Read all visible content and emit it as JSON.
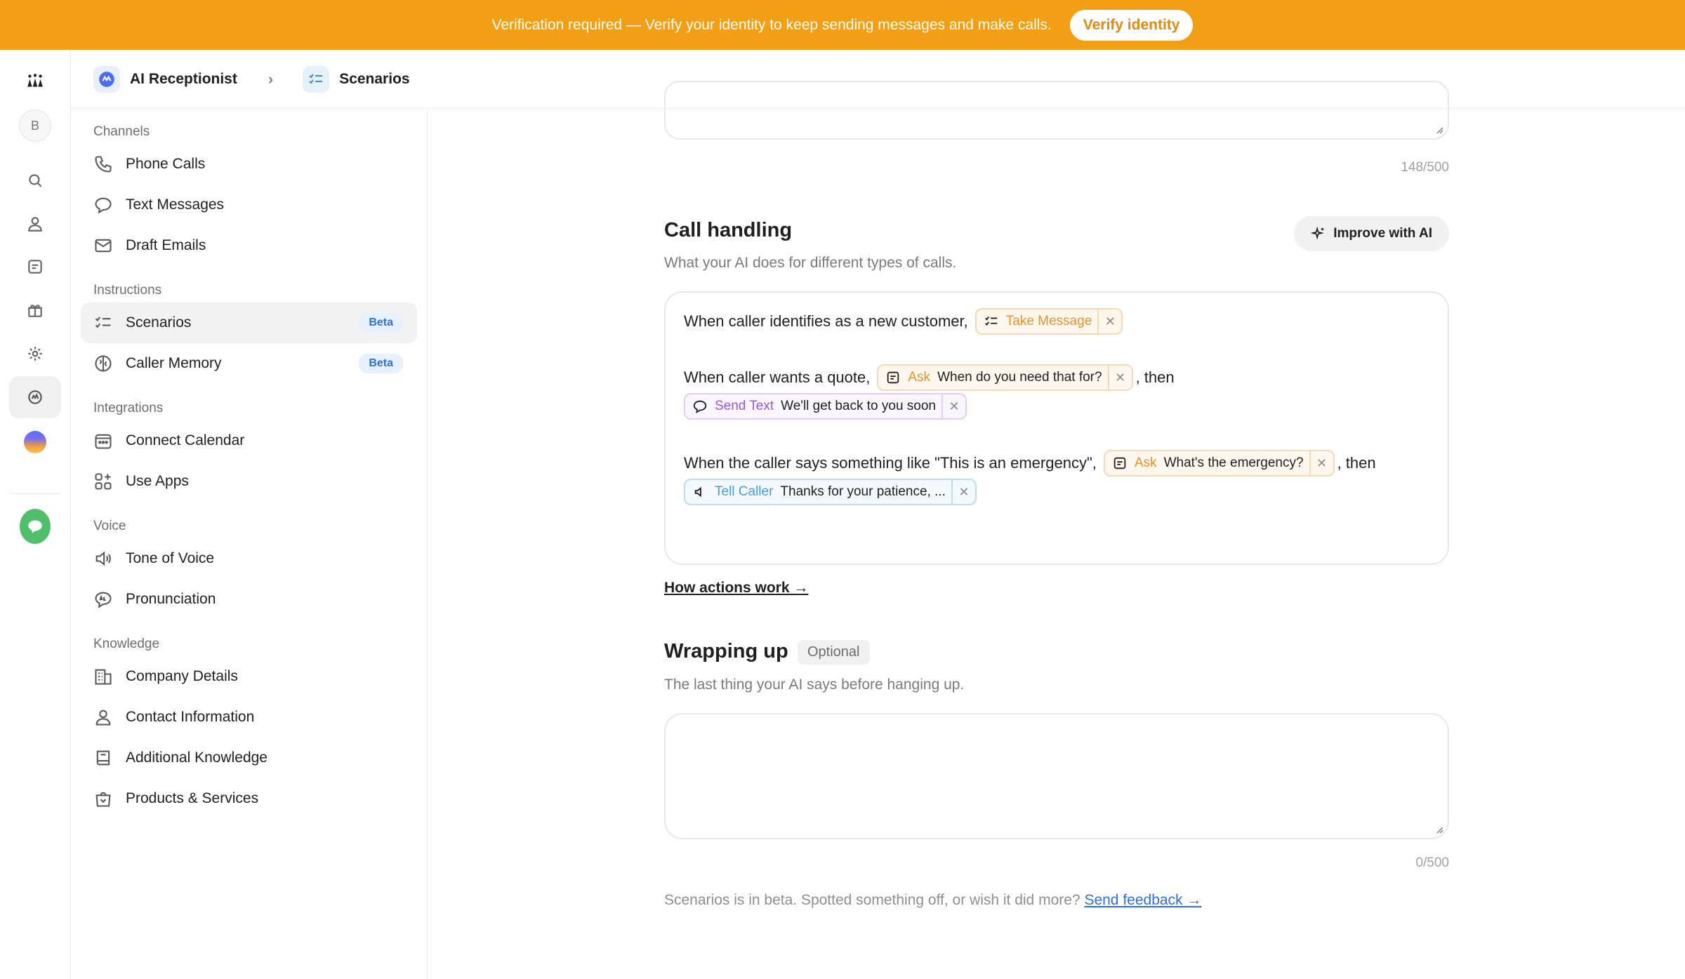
{
  "banner": {
    "text": "Verification required — Verify your identity to keep sending messages and make calls.",
    "button": "Verify identity",
    "color": "#f29f16"
  },
  "rail": {
    "avatar_letter": "B",
    "icons": [
      "team-logo-icon",
      "search-icon",
      "person-icon",
      "note-icon",
      "gift-icon",
      "settings-icon",
      "ai-receptionist-icon",
      "gradient-orb-icon",
      "chat-icon"
    ]
  },
  "breadcrumb": {
    "parent": "AI Receptionist",
    "current": "Scenarios"
  },
  "sidebar": {
    "channels_label": "Channels",
    "channels": [
      "Phone Calls",
      "Text Messages",
      "Draft Emails"
    ],
    "instructions_label": "Instructions",
    "instructions": [
      {
        "label": "Scenarios",
        "badge": "Beta"
      },
      {
        "label": "Caller Memory",
        "badge": "Beta"
      }
    ],
    "integrations_label": "Integrations",
    "integrations": [
      "Connect Calendar",
      "Use Apps"
    ],
    "voice_label": "Voice",
    "voice": [
      "Tone of Voice",
      "Pronunciation"
    ],
    "knowledge_label": "Knowledge",
    "knowledge": [
      "Company Details",
      "Contact Information",
      "Additional Knowledge",
      "Products & Services"
    ]
  },
  "main": {
    "top_counter": "148/500",
    "call_handling": {
      "title": "Call handling",
      "subtitle": "What your AI does for different types of calls.",
      "improve_button": "Improve with AI",
      "rules": [
        {
          "prefix": "When caller identifies as a new customer,",
          "actions": [
            {
              "action": "Take Message",
              "value": ""
            }
          ]
        },
        {
          "prefix": "When caller wants a quote,",
          "actions": [
            {
              "action": "Ask",
              "value": "When do you need that for?"
            },
            {
              "action": "Send Text",
              "value": "We'll get back to you soon"
            }
          ],
          "joiner": ", then"
        },
        {
          "prefix": "When the caller says something like \"This is an emergency\",",
          "actions": [
            {
              "action": "Ask",
              "value": "What's the emergency?"
            },
            {
              "action": "Tell Caller",
              "value": "Thanks for your patience, ..."
            }
          ],
          "joiner": ", then"
        }
      ],
      "link": "How actions work →"
    },
    "wrapping_up": {
      "title": "Wrapping up",
      "badge": "Optional",
      "subtitle": "The last thing your AI says before hanging up.",
      "counter": "0/500"
    },
    "footer": {
      "text": "Scenarios is in beta. Spotted something off, or wish it did more?",
      "link": "Send feedback →"
    }
  }
}
